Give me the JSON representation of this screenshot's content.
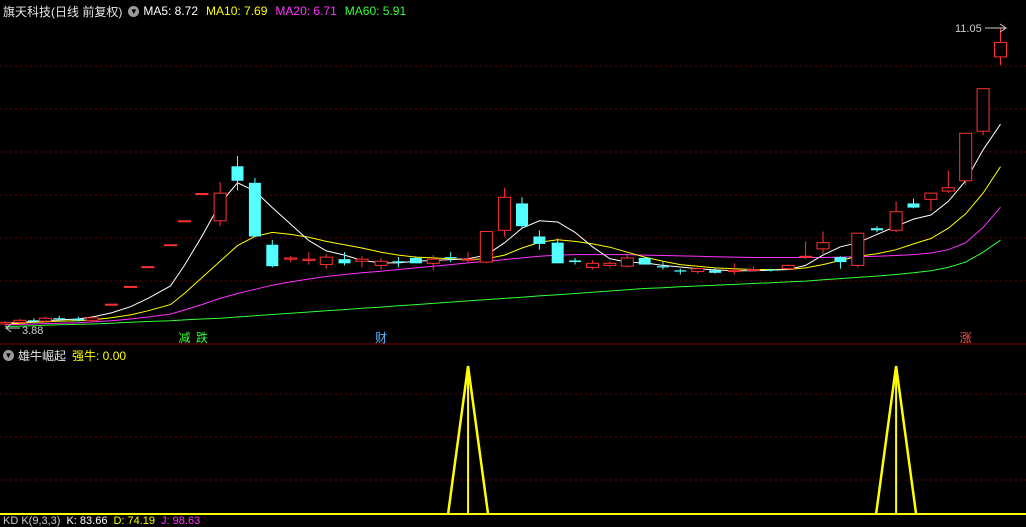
{
  "header": {
    "stock_title": "旗天科技(日线 前复权)",
    "ma_items": [
      {
        "label": "MA5: 8.72",
        "color": "#ffffff"
      },
      {
        "label": "MA10: 7.69",
        "color": "#ffff00"
      },
      {
        "label": "MA20: 6.71",
        "color": "#ff33ff"
      },
      {
        "label": "MA60: 5.91",
        "color": "#33ff33"
      }
    ]
  },
  "indicator": {
    "name": "雄牛崛起",
    "value_label": "强牛: 0.00",
    "value_color": "#ffff00"
  },
  "kd_bar": {
    "name": "KD K(9,3,3)",
    "k_label": "K: 83.66",
    "d_label": "D: 74.19",
    "j_label": "J: 98.63"
  },
  "chart_data": {
    "type": "candlestick",
    "price_high_label": "11.05",
    "price_low_label": "3.88",
    "ylim": [
      3.6,
      11.6
    ],
    "grid": "dashed-red",
    "colors": {
      "up": "#ff3232",
      "down": "#54ffff",
      "ma5": "#ffffff",
      "ma10": "#ffff00",
      "ma20": "#ff33ff",
      "ma60": "#33ff33"
    },
    "candles": [
      [
        3.88,
        3.95,
        3.84,
        3.92
      ],
      [
        3.92,
        4.0,
        3.86,
        3.97
      ],
      [
        3.97,
        4.02,
        3.9,
        3.95
      ],
      [
        3.95,
        4.05,
        3.92,
        4.02
      ],
      [
        4.02,
        4.08,
        3.95,
        4.0
      ],
      [
        4.0,
        4.06,
        3.94,
        3.97
      ],
      [
        3.97,
        4.05,
        3.92,
        4.03
      ],
      [
        4.36,
        4.36,
        4.36,
        4.36
      ],
      [
        4.79,
        4.79,
        4.79,
        4.79
      ],
      [
        5.27,
        5.27,
        5.27,
        5.27
      ],
      [
        5.8,
        5.8,
        5.8,
        5.8
      ],
      [
        6.38,
        6.38,
        6.38,
        6.38
      ],
      [
        7.04,
        7.04,
        7.04,
        7.04
      ],
      [
        6.38,
        7.32,
        6.25,
        7.05
      ],
      [
        7.7,
        7.95,
        7.12,
        7.35
      ],
      [
        7.3,
        7.42,
        6.0,
        6.0
      ],
      [
        5.8,
        5.92,
        5.25,
        5.28
      ],
      [
        5.45,
        5.52,
        5.38,
        5.48
      ],
      [
        5.42,
        5.62,
        5.32,
        5.45
      ],
      [
        5.32,
        5.58,
        5.22,
        5.5
      ],
      [
        5.45,
        5.62,
        5.3,
        5.35
      ],
      [
        5.4,
        5.52,
        5.25,
        5.45
      ],
      [
        5.3,
        5.48,
        5.2,
        5.4
      ],
      [
        5.4,
        5.5,
        5.25,
        5.38
      ],
      [
        5.48,
        5.52,
        5.35,
        5.35
      ],
      [
        5.35,
        5.55,
        5.18,
        5.45
      ],
      [
        5.5,
        5.62,
        5.38,
        5.48
      ],
      [
        5.45,
        5.62,
        5.38,
        5.45
      ],
      [
        5.38,
        6.1,
        5.35,
        6.12
      ],
      [
        6.15,
        7.18,
        6.0,
        6.95
      ],
      [
        6.8,
        6.95,
        6.2,
        6.25
      ],
      [
        6.0,
        6.15,
        5.68,
        5.82
      ],
      [
        5.85,
        5.95,
        5.35,
        5.35
      ],
      [
        5.42,
        5.48,
        5.32,
        5.38
      ],
      [
        5.25,
        5.42,
        5.2,
        5.35
      ],
      [
        5.3,
        5.4,
        5.25,
        5.35
      ],
      [
        5.28,
        5.55,
        5.25,
        5.48
      ],
      [
        5.48,
        5.5,
        5.32,
        5.32
      ],
      [
        5.28,
        5.38,
        5.2,
        5.25
      ],
      [
        5.18,
        5.22,
        5.08,
        5.15
      ],
      [
        5.15,
        5.25,
        5.1,
        5.22
      ],
      [
        5.18,
        5.25,
        5.1,
        5.12
      ],
      [
        5.15,
        5.35,
        5.08,
        5.18
      ],
      [
        5.2,
        5.28,
        5.15,
        5.2
      ],
      [
        5.2,
        5.22,
        5.15,
        5.18
      ],
      [
        5.22,
        5.32,
        5.18,
        5.3
      ],
      [
        5.5,
        5.88,
        5.45,
        5.52
      ],
      [
        5.7,
        6.12,
        5.58,
        5.85
      ],
      [
        5.5,
        5.52,
        5.22,
        5.38
      ],
      [
        5.3,
        6.08,
        5.25,
        6.08
      ],
      [
        6.2,
        6.25,
        6.1,
        6.15
      ],
      [
        6.15,
        6.85,
        6.1,
        6.6
      ],
      [
        6.8,
        6.92,
        6.68,
        6.7
      ],
      [
        6.9,
        7.0,
        6.62,
        7.05
      ],
      [
        7.1,
        7.6,
        7.05,
        7.18
      ],
      [
        7.35,
        8.45,
        7.25,
        8.5
      ],
      [
        8.55,
        9.58,
        8.45,
        9.58
      ],
      [
        10.35,
        11.05,
        10.15,
        10.7
      ]
    ],
    "candle_x": [
      6,
      23,
      39,
      52,
      68,
      90,
      106,
      128,
      150,
      170,
      196,
      212,
      232,
      253,
      273,
      293,
      313,
      334,
      355,
      375,
      396,
      416,
      438,
      458,
      478,
      498,
      518,
      538,
      559,
      580,
      600,
      620,
      641,
      661,
      681,
      701,
      721,
      741,
      762,
      782,
      802,
      822,
      844,
      866,
      886,
      906,
      926,
      946,
      966,
      986,
      1008,
      1030,
      1050,
      1070,
      1090,
      1110,
      1130,
      1150
    ],
    "ma5": [
      3.9,
      3.92,
      3.94,
      3.96,
      3.98,
      4.0,
      4.05,
      4.15,
      4.3,
      4.5,
      4.8,
      5.3,
      6.0,
      6.8,
      7.3,
      7.1,
      6.7,
      6.3,
      5.9,
      5.65,
      5.55,
      5.42,
      5.36,
      5.36,
      5.4,
      5.42,
      5.44,
      5.46,
      5.55,
      5.85,
      6.2,
      6.38,
      6.35,
      6.1,
      5.75,
      5.46,
      5.38,
      5.36,
      5.3,
      5.26,
      5.22,
      5.19,
      5.17,
      5.17,
      5.18,
      5.2,
      5.3,
      5.55,
      5.75,
      5.85,
      6.05,
      6.25,
      6.42,
      6.52,
      6.85,
      7.35,
      8.1,
      8.72
    ],
    "ma10": [
      3.88,
      3.9,
      3.92,
      3.93,
      3.95,
      3.96,
      3.98,
      4.03,
      4.1,
      4.2,
      4.35,
      4.62,
      5.0,
      5.4,
      5.78,
      6.0,
      6.1,
      6.05,
      5.98,
      5.88,
      5.8,
      5.72,
      5.62,
      5.55,
      5.5,
      5.48,
      5.46,
      5.44,
      5.46,
      5.55,
      5.72,
      5.86,
      5.92,
      5.88,
      5.82,
      5.74,
      5.62,
      5.5,
      5.4,
      5.32,
      5.28,
      5.24,
      5.22,
      5.2,
      5.2,
      5.2,
      5.24,
      5.32,
      5.42,
      5.52,
      5.58,
      5.68,
      5.82,
      5.95,
      6.2,
      6.55,
      7.05,
      7.69
    ],
    "ma20": [
      3.86,
      3.87,
      3.88,
      3.89,
      3.9,
      3.91,
      3.93,
      3.96,
      4.0,
      4.05,
      4.12,
      4.22,
      4.35,
      4.5,
      4.62,
      4.72,
      4.82,
      4.9,
      4.97,
      5.03,
      5.08,
      5.12,
      5.16,
      5.2,
      5.24,
      5.28,
      5.32,
      5.36,
      5.4,
      5.44,
      5.48,
      5.52,
      5.55,
      5.56,
      5.56,
      5.56,
      5.56,
      5.55,
      5.54,
      5.53,
      5.52,
      5.51,
      5.5,
      5.49,
      5.49,
      5.49,
      5.49,
      5.49,
      5.5,
      5.51,
      5.52,
      5.54,
      5.56,
      5.6,
      5.68,
      5.85,
      6.22,
      6.71
    ],
    "ma60": [
      3.82,
      3.83,
      3.84,
      3.85,
      3.86,
      3.87,
      3.88,
      3.9,
      3.92,
      3.94,
      3.96,
      3.98,
      4.0,
      4.02,
      4.05,
      4.08,
      4.11,
      4.14,
      4.17,
      4.2,
      4.23,
      4.26,
      4.29,
      4.32,
      4.35,
      4.38,
      4.41,
      4.44,
      4.47,
      4.5,
      4.53,
      4.56,
      4.59,
      4.62,
      4.65,
      4.68,
      4.71,
      4.74,
      4.76,
      4.78,
      4.8,
      4.82,
      4.84,
      4.86,
      4.88,
      4.9,
      4.92,
      4.95,
      4.98,
      5.01,
      5.04,
      5.08,
      5.12,
      5.17,
      5.25,
      5.38,
      5.62,
      5.91
    ],
    "markers": [
      {
        "text": "减",
        "color": "#33ff33",
        "index": 11
      },
      {
        "text": "跌",
        "color": "#33ff33",
        "index": 12
      },
      {
        "text": "财",
        "color": "#5ab8ff",
        "index": 22
      },
      {
        "text": "涨",
        "color": "#ff5555",
        "index": 55
      }
    ],
    "signal_indices": [
      27,
      51
    ],
    "signal_color": "#ffff00"
  }
}
